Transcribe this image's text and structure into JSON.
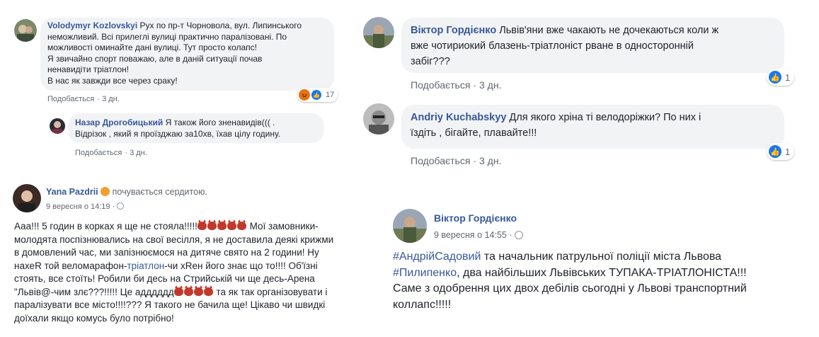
{
  "c1": {
    "author": "Volodymyr Kozlovskyi",
    "lines": [
      "Рух по пр-т Чорновола, вул. Липинського",
      "неможливий. Всі прилеглі вулиці практично паралізовані. По",
      "можливості оминайте дані вулиці. Тут просто колапс!",
      "Я звичайно спорт поважаю, але в даній ситуації почав",
      "ненавидіти тріатлон!",
      "В нас як завжди все через сраку!"
    ],
    "like_label": "Подобається",
    "time": "3 дн.",
    "reactions_count": "17"
  },
  "c2": {
    "author": "Назар Дрогобицький",
    "lines": [
      "Я також його зненавидів((( .",
      "Відрізок , який я проїзджаю за10хв, їхав цілу годину."
    ],
    "like_label": "Подобається",
    "time": "3 дн."
  },
  "c3": {
    "author": "Віктор Гордієнко",
    "lines": [
      "Львів'яни вже чакають не дочекаються коли ж",
      "вже чотириокий блазень-тріатлоніст рване в односторонній",
      "забіг???"
    ],
    "like_label": "Подобається",
    "time": "3 дн.",
    "likes": "1"
  },
  "c4": {
    "author": "Andriy Kuchabskyy",
    "lines": [
      "Для якого хріна ті велодоріжки? По них і",
      "їздіть , бігайте, плавайте!!!"
    ],
    "like_label": "Подобається",
    "time": "3 дн.",
    "likes": "1"
  },
  "p1": {
    "author": "Yana Pazdrii",
    "feeling": "почувається сердитою.",
    "date": "9 вересня о 14:19",
    "line1a": "Ааа!!! 5 годин в корках я ще не стояла!!!!!",
    "line1b": "Мої замовники-",
    "line2": "молодята поспізнювались на свої весілля, я не доставила деякі крижми",
    "line3": "в домовлений час, ми запізнюємося на дитяче свято на 2 години! Ну",
    "line4a": "нахеR той веломарафон-",
    "line4link": "тріатлон",
    "line4b": "-чи хRен його знає що то!!!! Об'їзні",
    "line5": "стоять, все стоїть! Робили би десь на Стрийській чи ще десь-Арена",
    "line6a": "\"Львів@-чим злє???!!!!! Це адддддд",
    "line6b": "та як так організовувати і",
    "line7": "паралізувати все місто!!!!??? Я такого не бачила ще! Цікаво чи швидкі",
    "line8": "доїхали якщо комусь було потрібно!"
  },
  "p2": {
    "author": "Віктор Гордієнко",
    "date": "9 вересня о 14:55",
    "line1link": "#АндрійСадовий",
    "line1b": " та начальник патрульної поліції міста Львова",
    "line2link": "#Пилипенко",
    "line2b": ", два найбільших Львівських ТУПАКА-ТРІАТЛОНІСТА!!!",
    "line3": "Саме з одобрення цих двох дебілів сьогодні у Львові транспортний",
    "line4": "коллапс!!!!!"
  },
  "colors": {
    "link": "#385898",
    "bubble": "#f2f3f5",
    "like_blue": "#1877f2",
    "angry": "#e9710f"
  },
  "icons": [
    "globe-icon",
    "angry-reaction-icon",
    "like-reaction-icon",
    "devil-emoji-icon"
  ]
}
